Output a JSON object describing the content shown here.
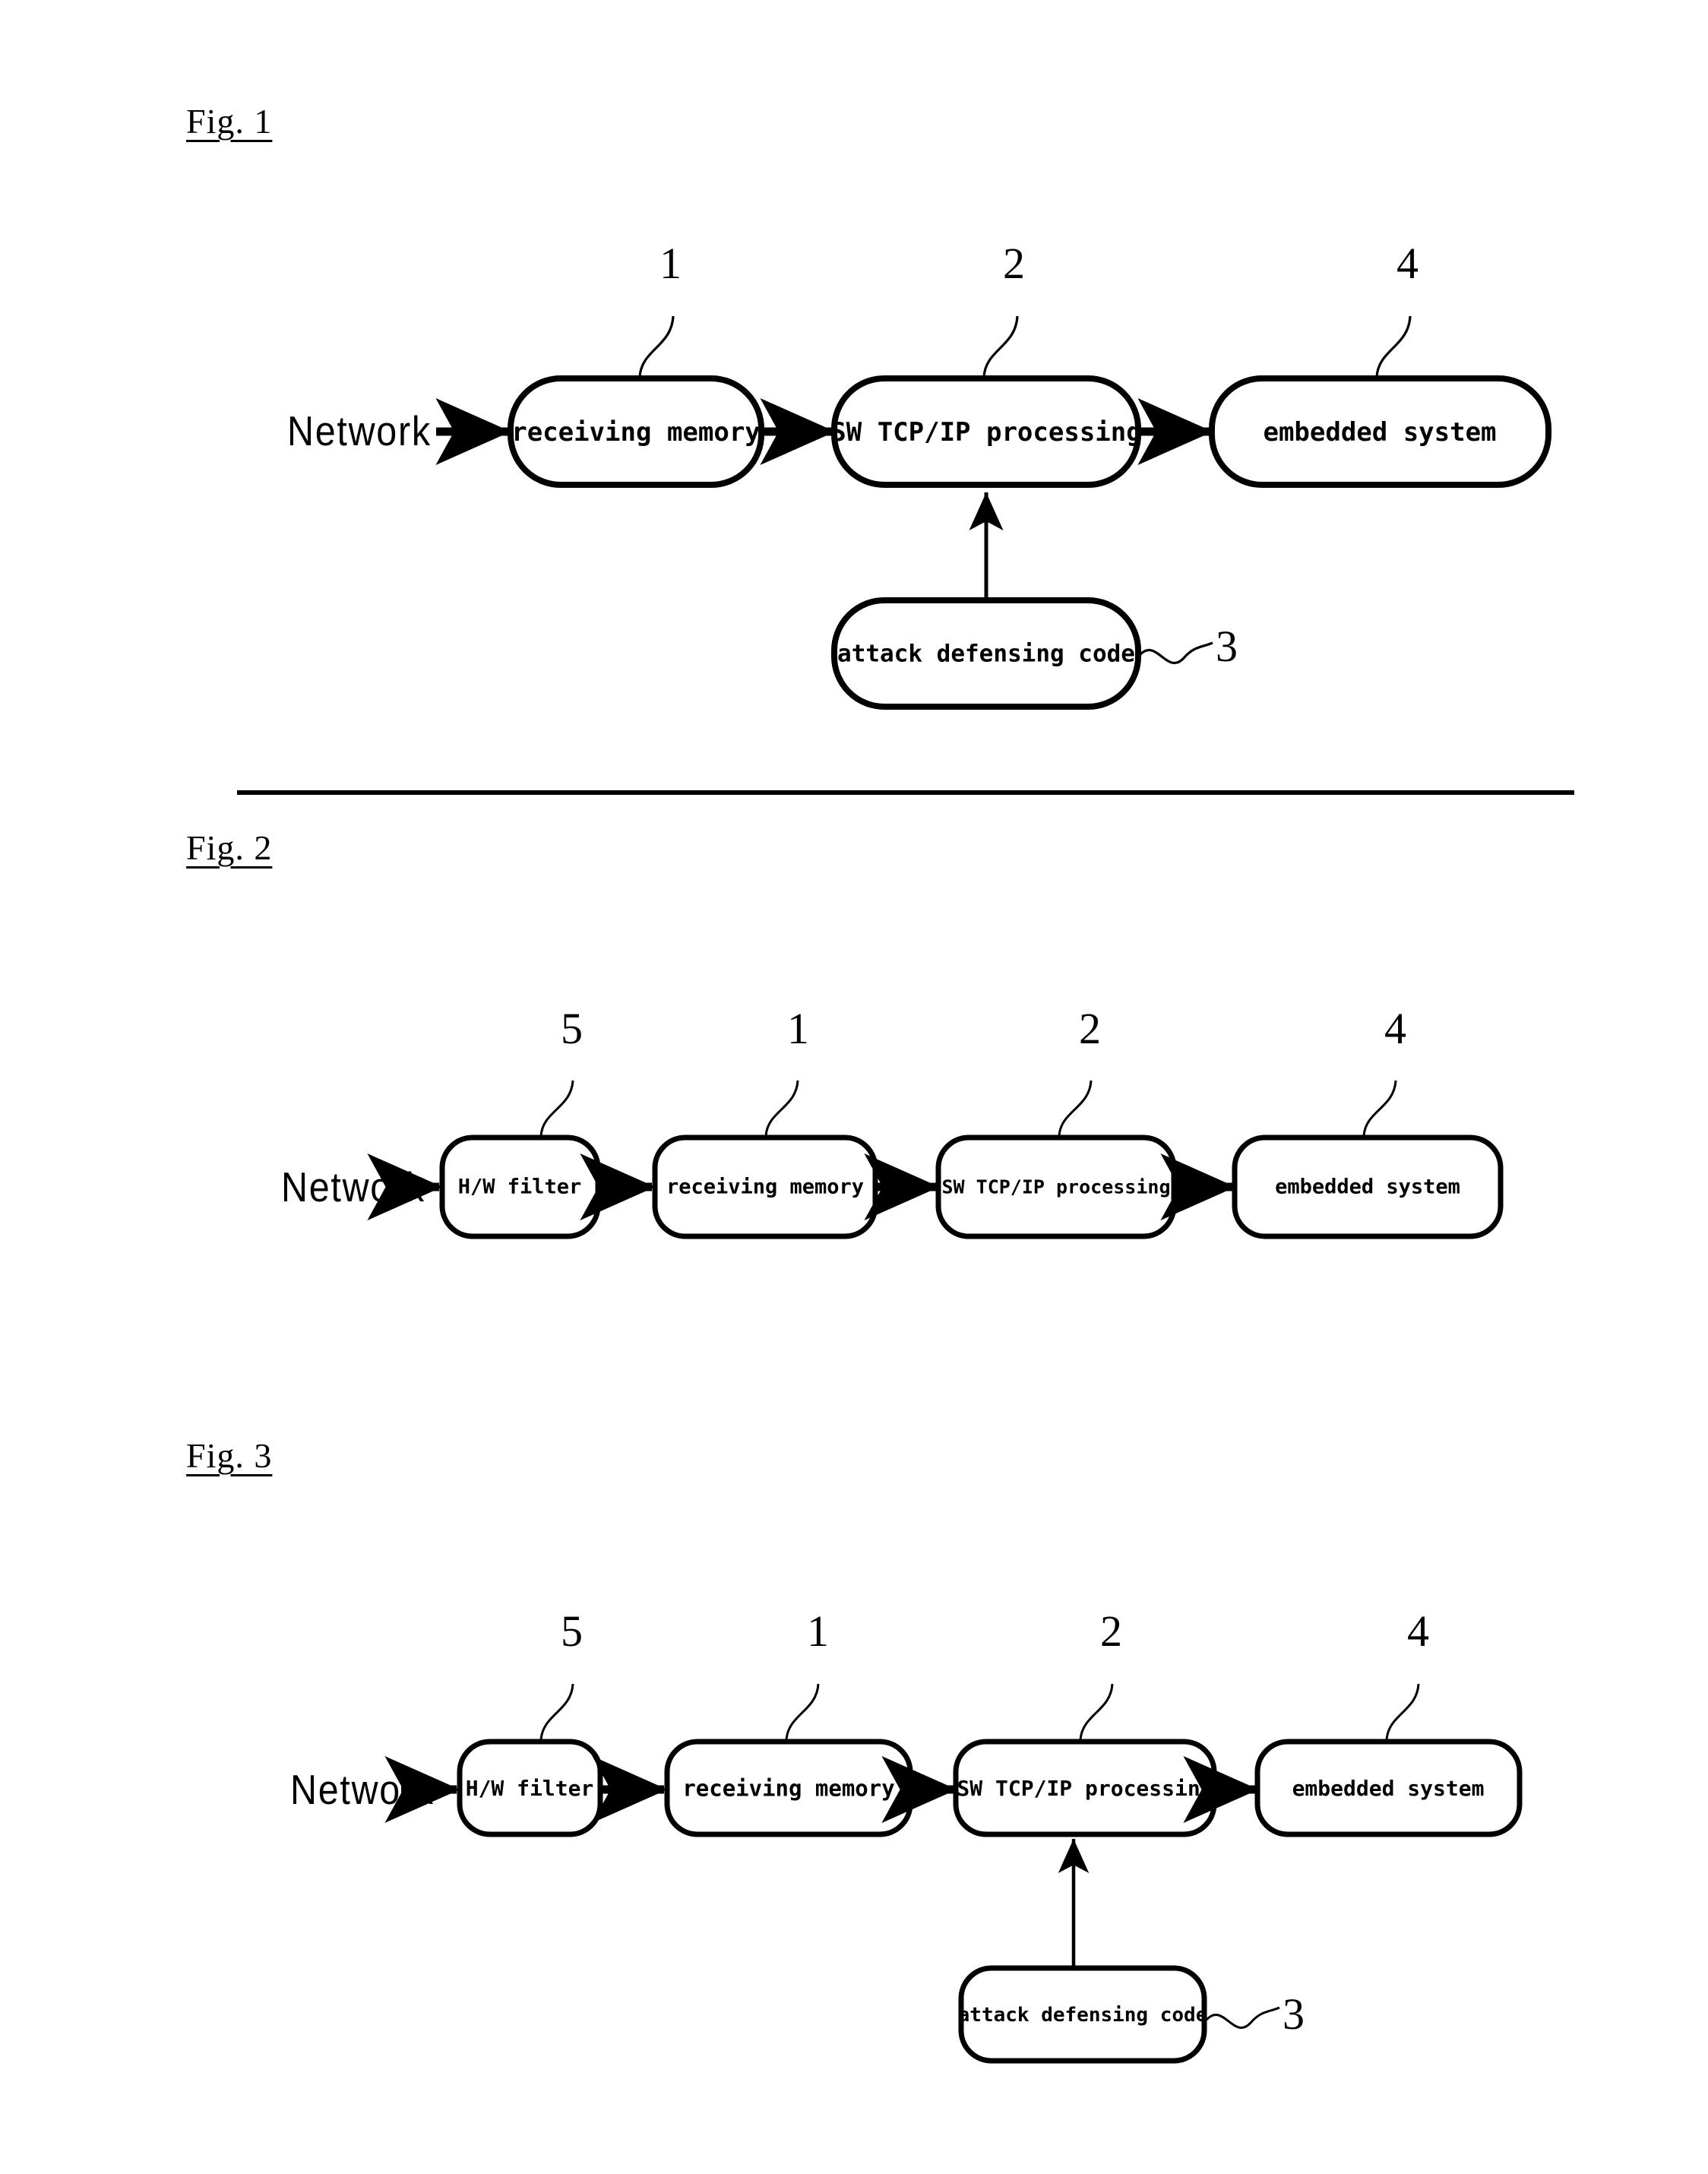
{
  "document": {
    "type": "patent-drawing-sheet",
    "background_color": "#ffffff",
    "ink_color": "#000000"
  },
  "figures": [
    {
      "id": "fig1",
      "caption": "Fig. 1",
      "source_label": "Network",
      "boxes": [
        {
          "id": "fig1-receiving-memory",
          "label": "receiving memory",
          "ref": "1"
        },
        {
          "id": "fig1-sw-tcpip",
          "label": "SW TCP/IP processing",
          "ref": "2"
        },
        {
          "id": "fig1-embedded-system",
          "label": "embedded system",
          "ref": "4"
        },
        {
          "id": "fig1-attack-defensing-code",
          "label": "attack defensing code",
          "ref": "3"
        }
      ],
      "refs": [
        "1",
        "2",
        "4",
        "3"
      ]
    },
    {
      "id": "fig2",
      "caption": "Fig. 2",
      "source_label": "Network",
      "boxes": [
        {
          "id": "fig2-hw-filter",
          "label": "H/W filter",
          "ref": "5"
        },
        {
          "id": "fig2-receiving-memory",
          "label": "receiving memory",
          "ref": "1"
        },
        {
          "id": "fig2-sw-tcpip",
          "label": "SW TCP/IP processing",
          "ref": "2"
        },
        {
          "id": "fig2-embedded-system",
          "label": "embedded system",
          "ref": "4"
        }
      ],
      "refs": [
        "5",
        "1",
        "2",
        "4"
      ]
    },
    {
      "id": "fig3",
      "caption": "Fig. 3",
      "source_label": "Network",
      "boxes": [
        {
          "id": "fig3-hw-filter",
          "label": "H/W filter",
          "ref": "5"
        },
        {
          "id": "fig3-receiving-memory",
          "label": "receiving memory",
          "ref": "1"
        },
        {
          "id": "fig3-sw-tcpip",
          "label": "SW TCP/IP processing",
          "ref": "2"
        },
        {
          "id": "fig3-embedded-system",
          "label": "embedded system",
          "ref": "4"
        },
        {
          "id": "fig3-attack-defensing-code",
          "label": "attack defensing code",
          "ref": "3"
        }
      ],
      "refs": [
        "5",
        "1",
        "2",
        "4",
        "3"
      ]
    }
  ],
  "fig1": {
    "caption": "Fig. 1",
    "network": "Network",
    "box_receiving_memory": "receiving memory",
    "box_sw_tcpip": "SW TCP/IP processing",
    "box_embedded_system": "embedded system",
    "box_attack_code": "attack defensing code",
    "ref_1": "1",
    "ref_2": "2",
    "ref_4": "4",
    "ref_3": "3"
  },
  "fig2": {
    "caption": "Fig. 2",
    "network": "Network",
    "box_hw_filter": "H/W filter",
    "box_receiving_memory": "receiving memory",
    "box_sw_tcpip": "SW TCP/IP processing",
    "box_embedded_system": "embedded system",
    "ref_5": "5",
    "ref_1": "1",
    "ref_2": "2",
    "ref_4": "4"
  },
  "fig3": {
    "caption": "Fig. 3",
    "network": "Network",
    "box_hw_filter": "H/W filter",
    "box_receiving_memory": "receiving memory",
    "box_sw_tcpip": "SW TCP/IP processing",
    "box_embedded_system": "embedded system",
    "box_attack_code": "attack defensing code",
    "ref_5": "5",
    "ref_1": "1",
    "ref_2": "2",
    "ref_4": "4",
    "ref_3": "3"
  }
}
